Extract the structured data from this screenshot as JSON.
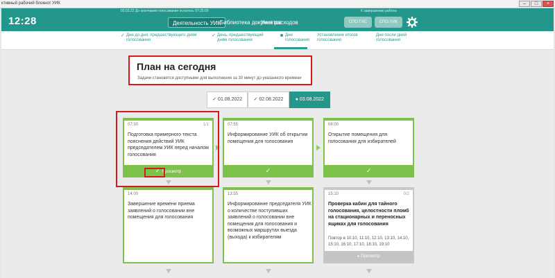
{
  "window": {
    "title": "ктивный рабочий блокнот УИК"
  },
  "appbar": {
    "topline_left": "03.03.22   До окончания голосования осталось 07:25:00",
    "topline_right": "К завершению работы",
    "clock": "12:28",
    "nav": [
      "Деятельность УИК",
      "Библиотека документов",
      "Учет расходов"
    ],
    "pills": [
      "СПО ГИС",
      "СПО УИК"
    ],
    "icons": {
      "settings": "gear-icon"
    }
  },
  "steps": [
    {
      "label": "Дни до дня, предшествующего дням голосования",
      "state": "done"
    },
    {
      "label": "День, предшествующий дням голосования",
      "state": "done"
    },
    {
      "label": "Дни голосования",
      "state": "current"
    },
    {
      "label": "Установление итогов голосования",
      "state": "future"
    },
    {
      "label": "Дни после дней голосования",
      "state": "future"
    }
  ],
  "plan": {
    "title": "План на сегодня",
    "subtitle": "Задачи становятся доступными для выполнения за 30 минут до указанного времени"
  },
  "dates": [
    {
      "label": "01.08.2022",
      "state": "done"
    },
    {
      "label": "02.08.2022",
      "state": "done"
    },
    {
      "label": "03.08.2022",
      "state": "selected"
    }
  ],
  "cards": [
    {
      "time": "07:30",
      "count": "1/1",
      "text": "Подготовка примерного текста пояснения действий УИК председателем УИК перед началом голосования",
      "footer": "Просмотр"
    },
    {
      "time": "07:55",
      "count": "",
      "text": "Информирование УИК об открытии помещения для голосования",
      "footer": "✓"
    },
    {
      "time": "08:00",
      "count": "",
      "text": "Открытие помещения для голосования для избирателей",
      "footer": "✓"
    },
    {
      "time": "14:00",
      "count": "",
      "text": "Завершение времени приема заявлений о голосовании вне помещения для голосования",
      "footer": ""
    },
    {
      "time": "13:55",
      "count": "",
      "text": "Информирование председателя УИК о количестве поступивших заявлений о голосовании вне помещения для голосования и возможных маршрутах выезда (выхода) к избирателям",
      "footer": ""
    },
    {
      "time": "15:10",
      "count": "0/2",
      "text": "Проверка кабин для тайного голосования, целостности пломб на стационарных и переносных ящиках для голосования",
      "repeat": "Повтор в 10:10, 11:10, 12:10, 13:10, 14:10, 15:10, 16:10, 17:10, 18:10, 19:10",
      "footer": "Просмотр"
    }
  ],
  "colors": {
    "accent": "#23978b",
    "done": "#7cc24b",
    "highlight": "#d7191c"
  }
}
